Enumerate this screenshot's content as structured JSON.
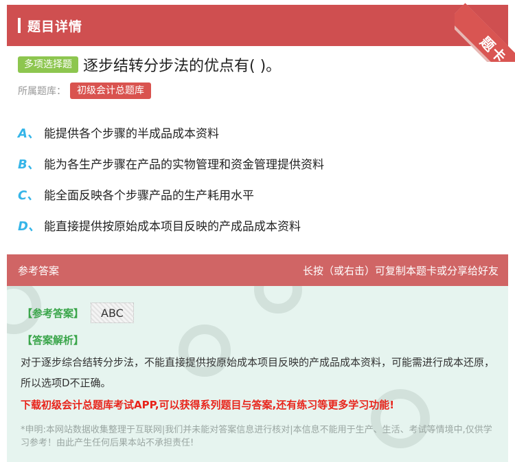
{
  "header": {
    "title": "题目详情",
    "corner_label": "题卡"
  },
  "question": {
    "type_badge": "多项选择题",
    "text": "逐步结转分步法的优点有( )。",
    "bank_label": "所属题库：",
    "bank_name": "初级会计总题库"
  },
  "options": [
    {
      "letter": "A、",
      "text": "能提供各个步骤的半成品成本资料"
    },
    {
      "letter": "B、",
      "text": "能为各生产步骤在产品的实物管理和资金管理提供资料"
    },
    {
      "letter": "C、",
      "text": "能全面反映各个步骤产品的生产耗用水平"
    },
    {
      "letter": "D、",
      "text": "能直接提供按原始成本项目反映的产成品成本资料"
    }
  ],
  "answer": {
    "head_left": "参考答案",
    "head_right": "长按（或右击）可复制本题卡或分享给好友",
    "ref_label": "【参考答案】",
    "ref_value": "ABC",
    "analysis_label": "【答案解析】",
    "analysis_text": "对于逐步综合结转分步法，不能直接提供按原始成本项目反映的产成品成本资料，可能需进行成本还原，所以选项D不正确。",
    "promo": "下载初级会计总题库考试APP,可以获得系列题目与答案,还有练习等更多学习功能!",
    "disclaimer": "*申明:本网站数据收集整理于互联网|我们并未能对答案信息进行核对|本信息不能用于生产、生活、考试等情境中,仅供学习参考！由此产生任何后果本站不承担责任!"
  },
  "colors": {
    "header_bg": "#cf4f50",
    "type_badge_bg": "#8dc64f",
    "bank_badge_bg": "#d9534f",
    "option_letter": "#35b5e8",
    "answer_head_bg": "#d06565",
    "answer_panel_bg": "#e6f4ef",
    "label_green": "#3aa54a",
    "promo_red": "#e8241b"
  }
}
